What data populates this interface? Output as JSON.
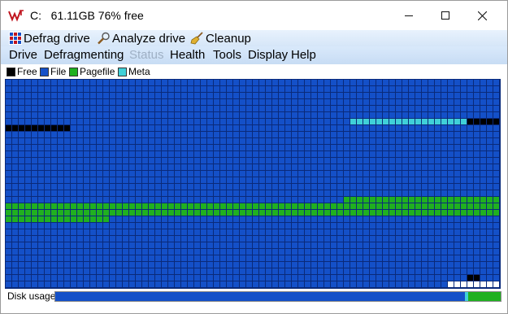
{
  "window": {
    "title": "C:   61.11GB 76% free"
  },
  "toolbar": {
    "defrag_label": "Defrag drive",
    "analyze_label": "Analyze drive",
    "cleanup_label": "Cleanup"
  },
  "menu": [
    {
      "label": "Drive",
      "enabled": true
    },
    {
      "label": "Defragmenting",
      "enabled": true
    },
    {
      "label": "Status",
      "enabled": false
    },
    {
      "label": "Health",
      "enabled": true
    },
    {
      "label": "Tools",
      "enabled": true
    },
    {
      "label": "Display",
      "enabled": true
    },
    {
      "label": "Help",
      "enabled": true
    }
  ],
  "legend": [
    {
      "label": "Free",
      "color": "#000000"
    },
    {
      "label": "File",
      "color": "#1450c8"
    },
    {
      "label": "Pagefile",
      "color": "#20b020"
    },
    {
      "label": "Meta",
      "color": "#40d0d8"
    }
  ],
  "colors": {
    "file": "#1450c8",
    "free": "#000000",
    "pagefile": "#20b020",
    "meta": "#40d0d8",
    "grid": "#0a2a7a",
    "empty": "#ffffff"
  },
  "disk_usage": {
    "label": "Disk usage",
    "file_fraction": 0.92,
    "meta_fraction": 0.008,
    "pagefile_fraction": 0.072
  }
}
